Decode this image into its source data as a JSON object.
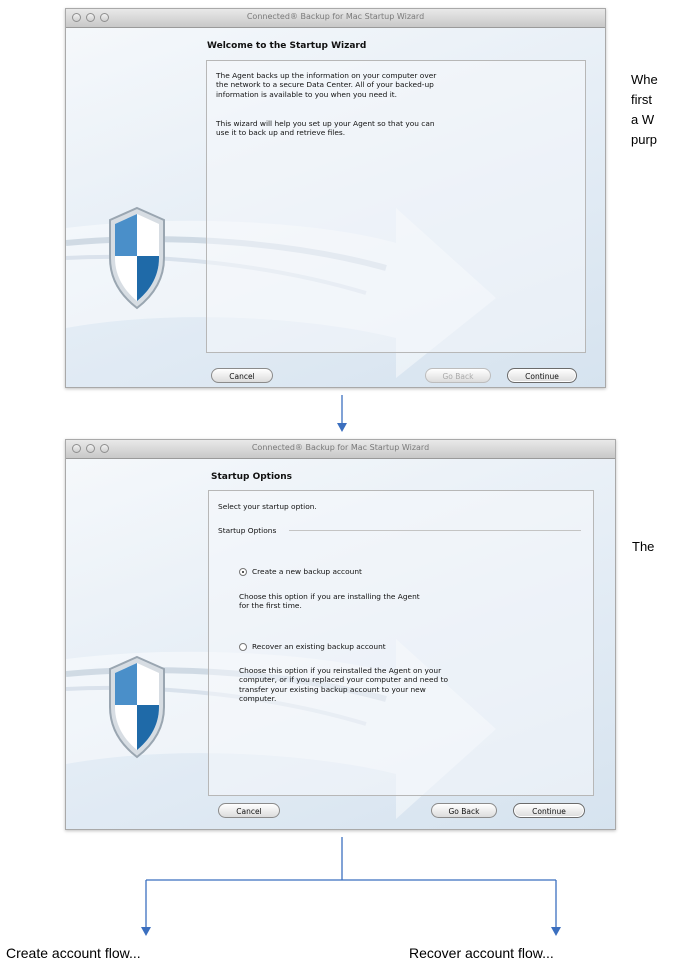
{
  "window1": {
    "title": "Connected® Backup for Mac Startup Wizard",
    "heading": "Welcome to the Startup Wizard",
    "para1": [
      "The Agent backs up the information on your computer over",
      "the network to a secure Data Center. All of your backed-up",
      "information is available to you when you need it."
    ],
    "para2": [
      "This wizard will help you set up your Agent so that you can",
      "use it to back up and retrieve files."
    ],
    "buttons": {
      "cancel": "Cancel",
      "go_back": "Go Back",
      "continue": "Continue"
    },
    "go_back_enabled": false
  },
  "window2": {
    "title": "Connected® Backup for Mac Startup Wizard",
    "heading": "Startup Options",
    "prompt": "Select your startup option.",
    "group_label": "Startup Options",
    "option1": {
      "label": "Create a new backup account",
      "selected": true,
      "description": [
        "Choose this option if you are installing the Agent",
        "for the first time."
      ]
    },
    "option2": {
      "label": "Recover an existing backup account",
      "selected": false,
      "description": [
        "Choose this option if you reinstalled the Agent on your",
        "computer, or if you replaced your computer and need to",
        "transfer your existing backup account to your new",
        "computer."
      ]
    },
    "buttons": {
      "cancel": "Cancel",
      "go_back": "Go Back",
      "continue": "Continue"
    }
  },
  "side_text_1": [
    "Whe",
    "first",
    "a W",
    "purp"
  ],
  "side_text_2": [
    "The"
  ],
  "flow": {
    "left_label": "Create account flow...",
    "right_label": "Recover account flow..."
  },
  "icons": {
    "shield": "shield-icon",
    "arrow": "arrow-down-icon"
  },
  "colors": {
    "connector": "#3b6fbf",
    "shield_blue": "#2f77b6"
  }
}
